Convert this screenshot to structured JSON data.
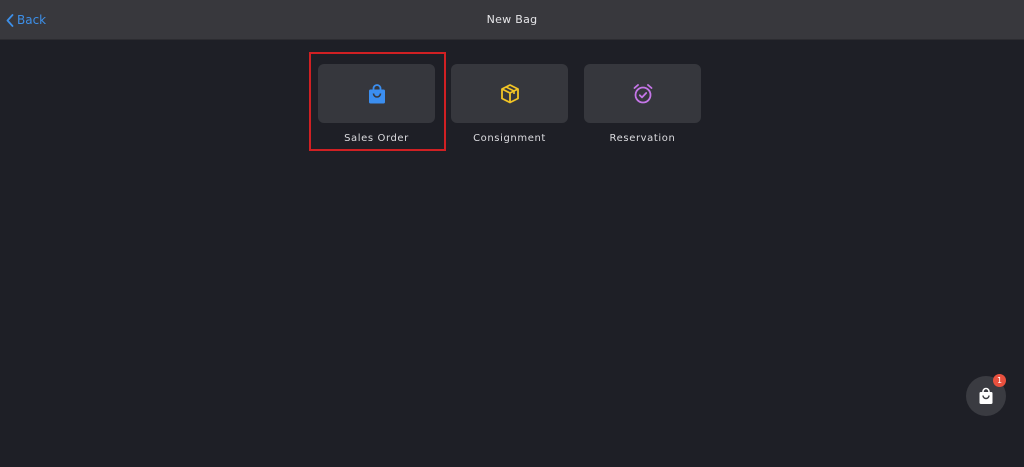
{
  "header": {
    "back_label": "Back",
    "title": "New Bag"
  },
  "options": [
    {
      "label": "Sales Order",
      "icon": "shopping-bag-icon",
      "color": "#3b8ef0",
      "selected": true
    },
    {
      "label": "Consignment",
      "icon": "package-box-icon",
      "color": "#f2c425"
    },
    {
      "label": "Reservation",
      "icon": "alarm-clock-check-icon",
      "color": "#c576e8"
    }
  ],
  "highlight_color": "#d02023",
  "bag_button": {
    "icon": "shopping-bag-icon",
    "count": "1",
    "badge_color": "#e8503e"
  }
}
